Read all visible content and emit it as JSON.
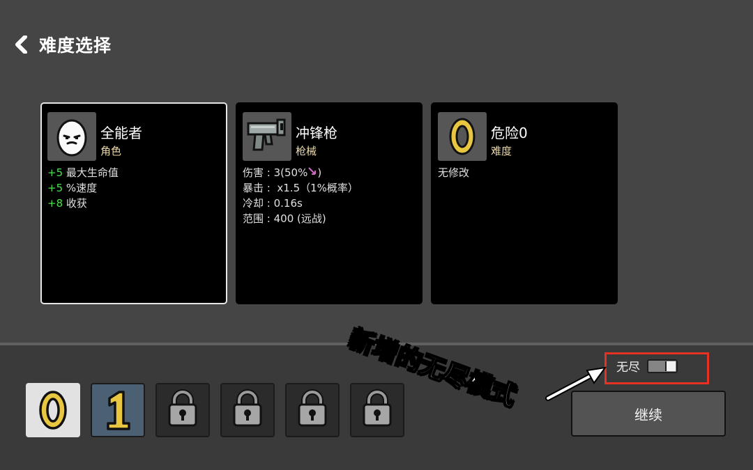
{
  "header": {
    "title": "难度选择",
    "back_icon": "chevron-left-icon"
  },
  "cards": [
    {
      "name": "全能者",
      "type": "角色",
      "icon": "potato-face-icon",
      "lines": [
        {
          "value": "+5",
          "label": "最大生命值"
        },
        {
          "value": "+5",
          "label": "%速度"
        },
        {
          "value": "+8",
          "label": "收获"
        }
      ]
    },
    {
      "name": "冲锋枪",
      "type": "枪械",
      "icon": "smg-gun-icon",
      "lines": [
        {
          "label": "伤害",
          "value": "3(50%",
          "suffix": ")",
          "suffix_icon": "ranged-damage-icon"
        },
        {
          "label": "暴击",
          "value": "x1.5（1%概率）"
        },
        {
          "label": "冷却",
          "value": "0.16s"
        },
        {
          "label": "范围",
          "value": "400 (远战)"
        }
      ]
    },
    {
      "name": "危险0",
      "type": "难度",
      "icon": "danger-zero-icon",
      "lines": [
        {
          "text": "无修改"
        }
      ]
    }
  ],
  "difficulty_levels": [
    {
      "label": "0",
      "state": "selected"
    },
    {
      "label": "1",
      "state": "unlocked"
    },
    {
      "label": "",
      "state": "locked",
      "icon": "padlock-icon"
    },
    {
      "label": "",
      "state": "locked",
      "icon": "padlock-icon"
    },
    {
      "label": "",
      "state": "locked",
      "icon": "padlock-icon"
    },
    {
      "label": "",
      "state": "locked",
      "icon": "padlock-icon"
    }
  ],
  "endless": {
    "label": "无尽",
    "toggle_on": true
  },
  "continue_button": {
    "label": "继续"
  },
  "annotation": {
    "text": "新增的无尽模式",
    "highlight_color": "#e53222"
  },
  "colors": {
    "bonus_green": "#4ce14c",
    "type_yellow": "#ecd9a7",
    "number_gold": "#e8c640"
  }
}
